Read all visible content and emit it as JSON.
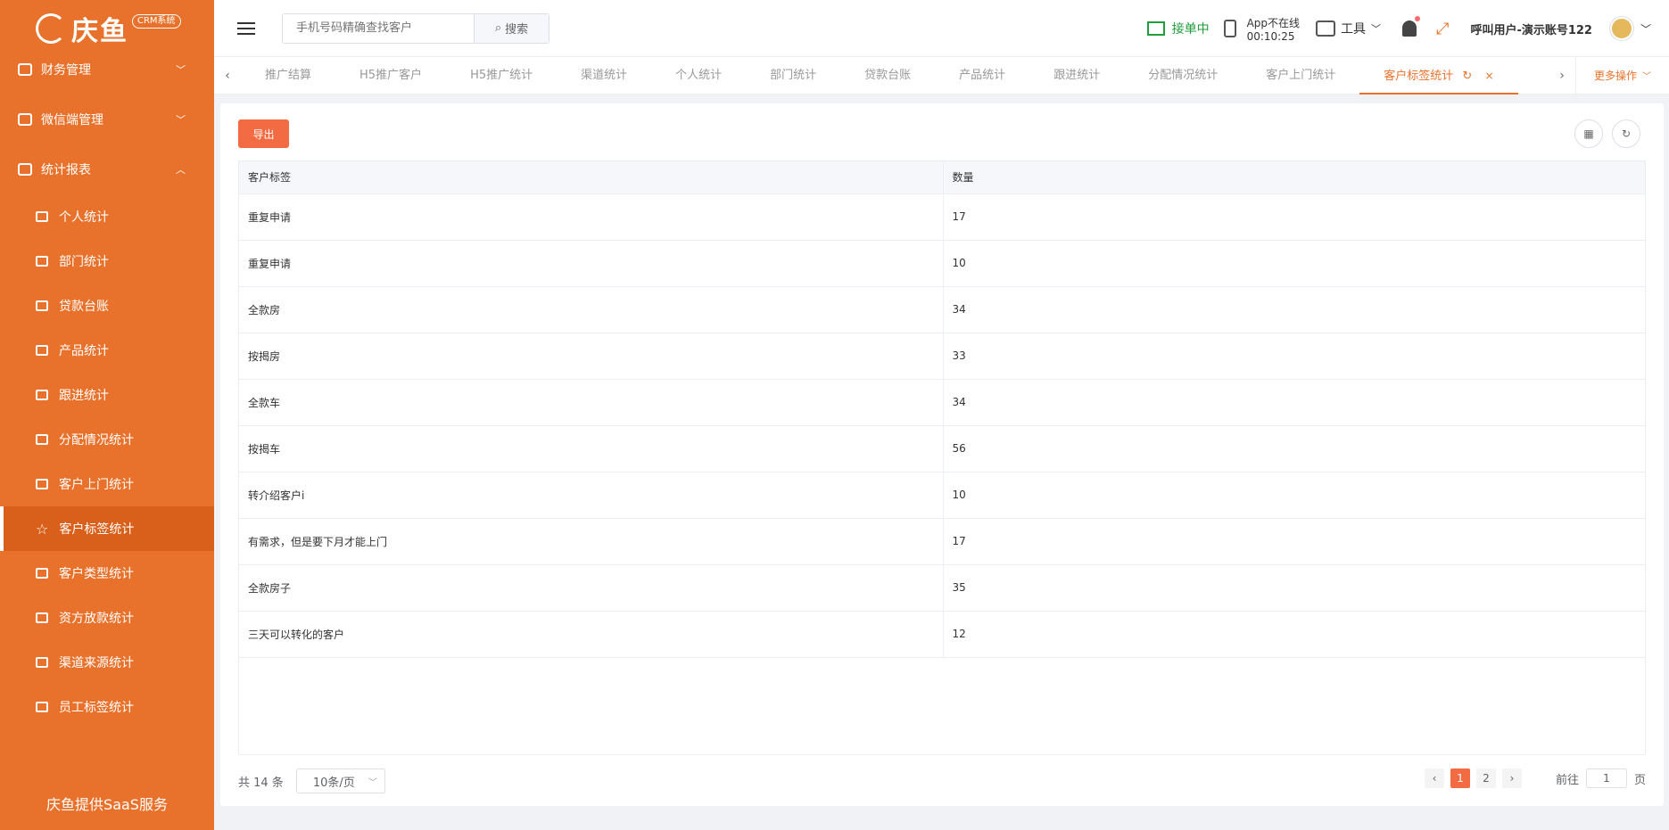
{
  "sidebar": {
    "logo_text": "庆鱼",
    "logo_badge": "CRM系统",
    "groups": [
      {
        "label": "财务管理",
        "arrow": "﹀"
      },
      {
        "label": "微信端管理",
        "arrow": "﹀"
      },
      {
        "label": "统计报表",
        "arrow": "︿"
      }
    ],
    "items": [
      {
        "label": "个人统计"
      },
      {
        "label": "部门统计"
      },
      {
        "label": "贷款台账"
      },
      {
        "label": "产品统计"
      },
      {
        "label": "跟进统计"
      },
      {
        "label": "分配情况统计"
      },
      {
        "label": "客户上门统计"
      },
      {
        "label": "客户标签统计"
      },
      {
        "label": "客户类型统计"
      },
      {
        "label": "资方放款统计"
      },
      {
        "label": "渠道来源统计"
      },
      {
        "label": "员工标签统计"
      }
    ],
    "footer": "庆鱼提供SaaS服务"
  },
  "header": {
    "search_placeholder": "手机号码精确查找客户",
    "search_button": "搜索",
    "status": "接单中",
    "app_status": "App不在线",
    "app_time": "00:10:25",
    "tools": "工具",
    "user": "呼叫用户-演示账号122"
  },
  "tabs": {
    "items": [
      "推广结算",
      "H5推广客户",
      "H5推广统计",
      "渠道统计",
      "个人统计",
      "部门统计",
      "贷款台账",
      "产品统计",
      "跟进统计",
      "分配情况统计",
      "客户上门统计"
    ],
    "active": "客户标签统计",
    "more": "更多操作"
  },
  "main": {
    "export_label": "导出",
    "columns": [
      "客户标签",
      "数量"
    ],
    "rows": [
      [
        "重复申请",
        "17"
      ],
      [
        "重复申请",
        "10"
      ],
      [
        "全款房",
        "34"
      ],
      [
        "按揭房",
        "33"
      ],
      [
        "全款车",
        "34"
      ],
      [
        "按揭车",
        "56"
      ],
      [
        "转介绍客户i",
        "10"
      ],
      [
        "有需求，但是要下月才能上门",
        "17"
      ],
      [
        "全款房子",
        "35"
      ],
      [
        "三天可以转化的客户",
        "12"
      ]
    ]
  },
  "pagination": {
    "total": "共 14 条",
    "page_size": "10条/页",
    "pages": [
      "1",
      "2"
    ],
    "goto_prefix": "前往",
    "goto_value": "1",
    "goto_suffix": "页"
  }
}
